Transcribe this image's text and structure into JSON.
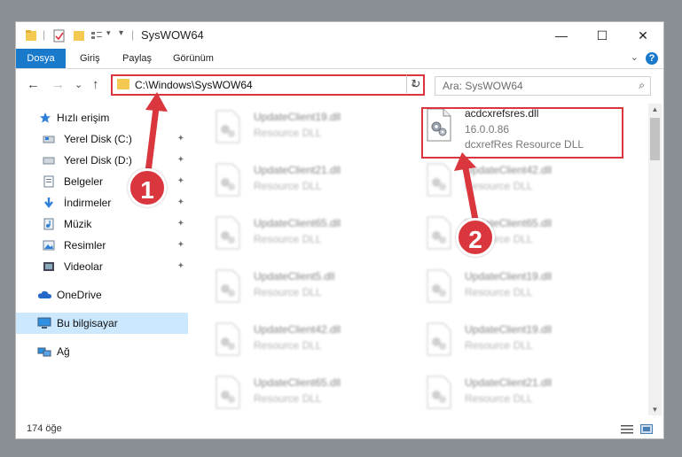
{
  "window": {
    "title": "SysWOW64",
    "controls": {
      "minimize": "—",
      "maximize": "☐",
      "close": "✕"
    }
  },
  "ribbon": {
    "tabs": [
      "Dosya",
      "Giriş",
      "Paylaş",
      "Görünüm"
    ],
    "help": "?",
    "accent": "#1979ca"
  },
  "nav": {
    "back": "←",
    "forward": "→",
    "recent": "⌄",
    "up": "↑",
    "address": "C:\\Windows\\SysWOW64",
    "refresh": "↻",
    "search_placeholder": "Ara: SysWOW64",
    "search_icon": "search-icon"
  },
  "sidebar": {
    "items": [
      {
        "label": "Hızlı erişim",
        "icon": "star-icon",
        "pinned": false
      },
      {
        "label": "Yerel Disk (C:)",
        "icon": "drive-icon",
        "pinned": true
      },
      {
        "label": "Yerel Disk (D:)",
        "icon": "drive-icon",
        "pinned": true
      },
      {
        "label": "Belgeler",
        "icon": "documents-icon",
        "pinned": true
      },
      {
        "label": "İndirmeler",
        "icon": "download-icon",
        "pinned": true
      },
      {
        "label": "Müzik",
        "icon": "music-icon",
        "pinned": true
      },
      {
        "label": "Resimler",
        "icon": "pictures-icon",
        "pinned": true
      },
      {
        "label": "Videolar",
        "icon": "video-icon",
        "pinned": true
      },
      {
        "label": "OneDrive",
        "icon": "cloud-icon",
        "pinned": false
      },
      {
        "label": "Bu bilgisayar",
        "icon": "computer-icon",
        "pinned": false,
        "selected": true
      },
      {
        "label": "Ağ",
        "icon": "network-icon",
        "pinned": false
      }
    ],
    "pin_glyph": "📌"
  },
  "files": {
    "left_column": [
      {
        "name": "UpdateClient19.dll",
        "type": "Resource DLL"
      },
      {
        "name": "UpdateClient21.dll",
        "type": "Resource DLL"
      },
      {
        "name": "UpdateClient65.dll",
        "type": "Resource DLL"
      },
      {
        "name": "UpdateClient5.dll",
        "type": "Resource DLL"
      },
      {
        "name": "UpdateClient42.dll",
        "type": "Resource DLL"
      },
      {
        "name": "UpdateClient65.dll",
        "type": "Resource DLL"
      }
    ],
    "highlighted": {
      "name": "acdcxrefsres.dll",
      "version": "16.0.0.86",
      "type": "dcxrefRes Resource DLL"
    },
    "right_column": [
      {
        "name": "UpdateClient42.dll",
        "type": "Resource DLL"
      },
      {
        "name": "UpdateClient65.dll",
        "type": "Resource DLL"
      },
      {
        "name": "UpdateClient19.dll",
        "type": "Resource DLL"
      },
      {
        "name": "UpdateClient19.dll",
        "type": "Resource DLL"
      },
      {
        "name": "UpdateClient21.dll",
        "type": "Resource DLL"
      }
    ]
  },
  "status": {
    "count": "174 öğe"
  },
  "annotations": {
    "marker1": "1",
    "marker2": "2",
    "color": "#d9363e"
  }
}
